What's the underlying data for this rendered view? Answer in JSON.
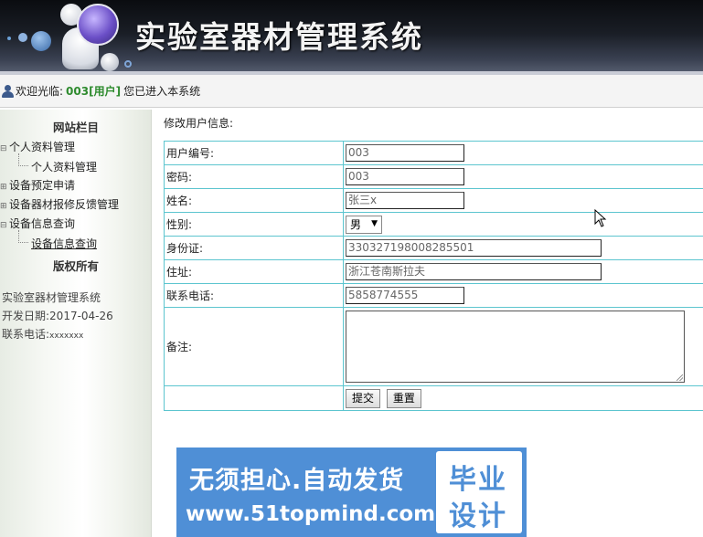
{
  "header": {
    "title": "实验室器材管理系统"
  },
  "welcome": {
    "greeting": "欢迎光临:",
    "username": "003[用户]",
    "suffix": "您已进入本系统"
  },
  "sidebar": {
    "section_title": "网站栏目",
    "items": [
      {
        "label": "个人资料管理"
      },
      {
        "label": "个人资料管理"
      },
      {
        "label": "设备预定申请"
      },
      {
        "label": "设备器材报修反馈管理"
      },
      {
        "label": "设备信息查询"
      },
      {
        "label": "设备信息查询"
      }
    ],
    "copyright_title": "版权所有",
    "info": {
      "system_name": "实验室器材管理系统",
      "dev_date_label": "开发日期:",
      "dev_date": "2017-04-26",
      "phone_label": "联系电话:",
      "phone": "xxxxxxx"
    }
  },
  "main": {
    "heading": "修改用户信息:",
    "fields": {
      "user_id": {
        "label": "用户编号:",
        "value": "003"
      },
      "password": {
        "label": "密码:",
        "value": "003"
      },
      "name": {
        "label": "姓名:",
        "value": "张三x"
      },
      "gender": {
        "label": "性别:",
        "value": "男"
      },
      "id_card": {
        "label": "身份证:",
        "value": "330327198008285501"
      },
      "address": {
        "label": "住址:",
        "value": "浙江苍南斯拉夫"
      },
      "phone": {
        "label": "联系电话:",
        "value": "5858774555"
      },
      "remark": {
        "label": "备注:",
        "value": ""
      }
    },
    "submit_label": "提交",
    "reset_label": "重置"
  },
  "promo": {
    "line1": "无须担心.自动发货",
    "line2": "www.51topmind.com",
    "badge_top": "毕业",
    "badge_bottom": "设计"
  }
}
